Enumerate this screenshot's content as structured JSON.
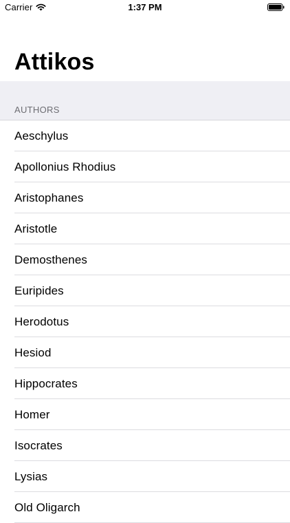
{
  "status_bar": {
    "carrier": "Carrier",
    "time": "1:37 PM",
    "wifi_icon": "wifi-icon",
    "battery_icon": "battery-full-icon"
  },
  "nav": {
    "title": "Attikos"
  },
  "section": {
    "header": "AUTHORS"
  },
  "authors": [
    {
      "name": "Aeschylus"
    },
    {
      "name": "Apollonius Rhodius"
    },
    {
      "name": "Aristophanes"
    },
    {
      "name": "Aristotle"
    },
    {
      "name": "Demosthenes"
    },
    {
      "name": "Euripides"
    },
    {
      "name": "Herodotus"
    },
    {
      "name": "Hesiod"
    },
    {
      "name": "Hippocrates"
    },
    {
      "name": "Homer"
    },
    {
      "name": "Isocrates"
    },
    {
      "name": "Lysias"
    },
    {
      "name": "Old Oligarch"
    }
  ],
  "colors": {
    "section_background": "#efeff4",
    "section_text": "#6d6d72",
    "separator": "#dcdce0",
    "text": "#000000"
  }
}
